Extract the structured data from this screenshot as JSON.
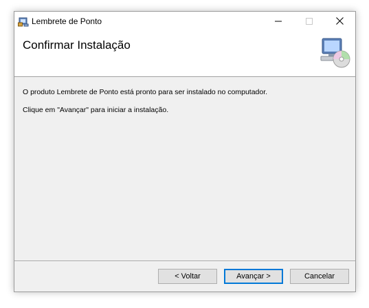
{
  "window": {
    "title": "Lembrete de Ponto",
    "app_icon": "installer-icon",
    "controls": {
      "minimize_icon": "minimize-icon",
      "maximize_icon": "maximize-icon",
      "close_icon": "close-icon"
    }
  },
  "header": {
    "title": "Confirmar Instalação",
    "icon": "computer-cd-icon"
  },
  "content": {
    "line1": "O produto Lembrete de Ponto está pronto para ser instalado no computador.",
    "line2": "Clique em \"Avançar\" para iniciar a instalação."
  },
  "buttons": {
    "back_label": "< Voltar",
    "next_label": "Avançar >",
    "cancel_label": "Cancelar"
  },
  "colors": {
    "focus_border": "#0078d7",
    "dialog_bg": "#f0f0f0",
    "header_bg": "#ffffff"
  }
}
